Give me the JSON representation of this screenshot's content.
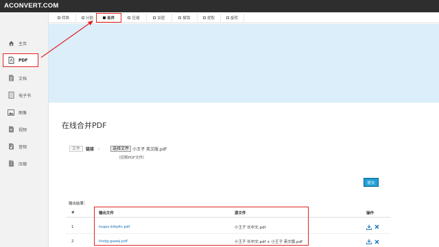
{
  "app": {
    "logo": "ACONVERT.COM"
  },
  "sidebar": {
    "items": [
      {
        "label": "主页",
        "icon": "home-icon"
      },
      {
        "label": "PDF",
        "icon": "pdf-icon",
        "active": true
      },
      {
        "label": "文档",
        "icon": "document-icon"
      },
      {
        "label": "电子书",
        "icon": "ebook-icon"
      },
      {
        "label": "图像",
        "icon": "image-icon"
      },
      {
        "label": "视频",
        "icon": "video-icon"
      },
      {
        "label": "音频",
        "icon": "audio-icon"
      },
      {
        "label": "压缩",
        "icon": "archive-icon"
      }
    ]
  },
  "tabs": [
    {
      "label": "转换"
    },
    {
      "label": "分割"
    },
    {
      "label": "合并",
      "active": true
    },
    {
      "label": "压缩"
    },
    {
      "label": "加密"
    },
    {
      "label": "解锁"
    },
    {
      "label": "提取"
    },
    {
      "label": "旋转"
    }
  ],
  "main": {
    "title": "在线合并PDF",
    "source_tabs": {
      "file": "文件",
      "link": "链接"
    },
    "colon": ":",
    "choose_button": "选择文件",
    "selected_file": "小王子 英文版.pdf",
    "hint": "（仅限PDF文件）",
    "submit_button": "提交"
  },
  "results": {
    "label": "输出结果：",
    "columns": [
      "#",
      "输出文件",
      "源文件",
      "操作"
    ],
    "rows": [
      {
        "num": "1",
        "output": "toqes-b9q4n.pdf",
        "source": "小王子 长中文.pdf"
      },
      {
        "num": "2",
        "output": "tindg-gaaej.pdf",
        "source": "小王子 长中文.pdf + 小王子 英文版.pdf"
      }
    ]
  },
  "colors": {
    "highlight": "#e02020",
    "accent": "#1f9fd6",
    "banner": "#dbeefa",
    "link": "#1a74b8"
  }
}
